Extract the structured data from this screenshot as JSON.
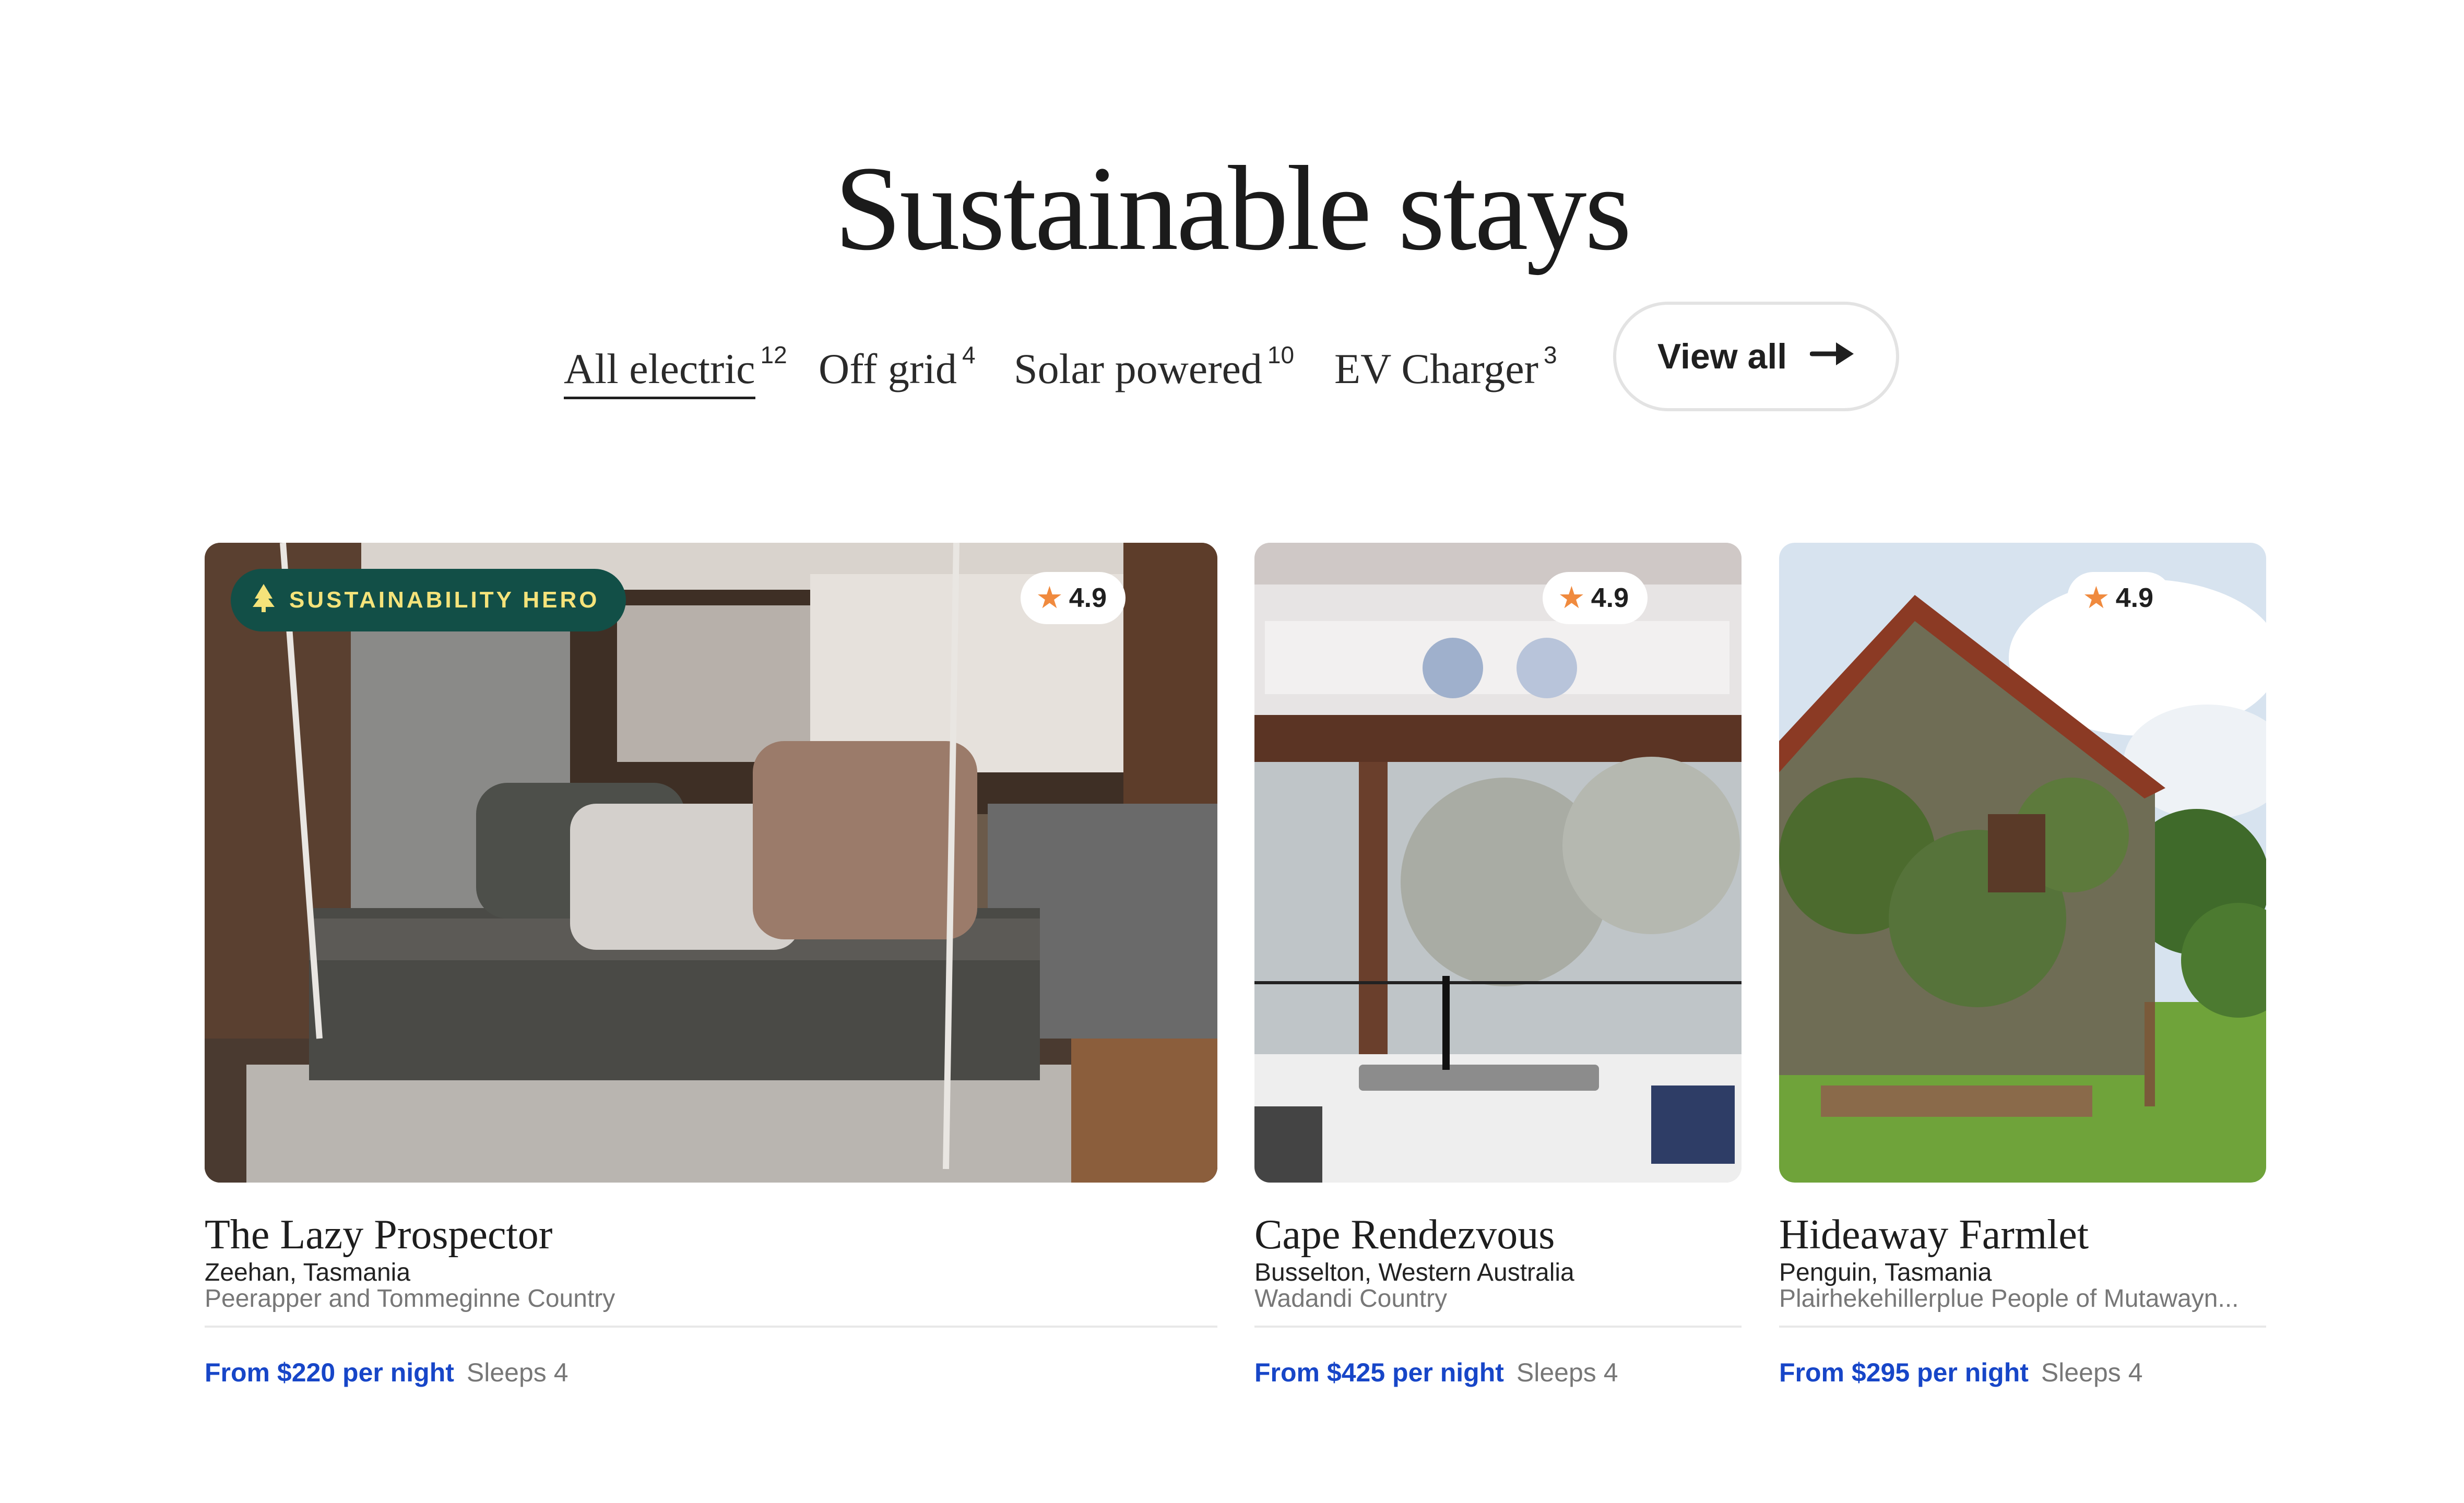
{
  "section": {
    "title": "Sustainable stays"
  },
  "filters": [
    {
      "label": "All electric",
      "count": "12",
      "active": true
    },
    {
      "label": "Off grid",
      "count": "4",
      "active": false
    },
    {
      "label": "Solar powered",
      "count": "10",
      "active": false
    },
    {
      "label": "EV Charger",
      "count": "3",
      "active": false
    }
  ],
  "view_all": {
    "label": "View all",
    "icon": "arrow-right-icon"
  },
  "listings": [
    {
      "name": "The Lazy Prospector",
      "location": "Zeehan, Tasmania",
      "country": "Peerapper and Tommeginne Country",
      "rating": "4.9",
      "badge": "SUSTAINABILITY HERO",
      "price": "From $220",
      "price_unit": "per night",
      "sleeps_label": "Sleeps",
      "sleeps": "4"
    },
    {
      "name": "Cape Rendezvous",
      "location": "Busselton, Western Australia",
      "country": "Wadandi Country",
      "rating": "4.9",
      "price": "From $425",
      "price_unit": "per night",
      "sleeps_label": "Sleeps",
      "sleeps": "4"
    },
    {
      "name": "Hideaway Farmlet",
      "location": "Penguin, Tasmania",
      "country": "Plairhekehillerplue People of Mutawayn...",
      "rating": "4.9",
      "price": "From $295",
      "price_unit": "per night",
      "sleeps_label": "Sleeps",
      "sleeps": "4"
    }
  ],
  "colors": {
    "price_blue": "#1746c8",
    "badge_bg": "#124f47",
    "badge_text": "#f5e37a",
    "star": "#f08a3e"
  }
}
